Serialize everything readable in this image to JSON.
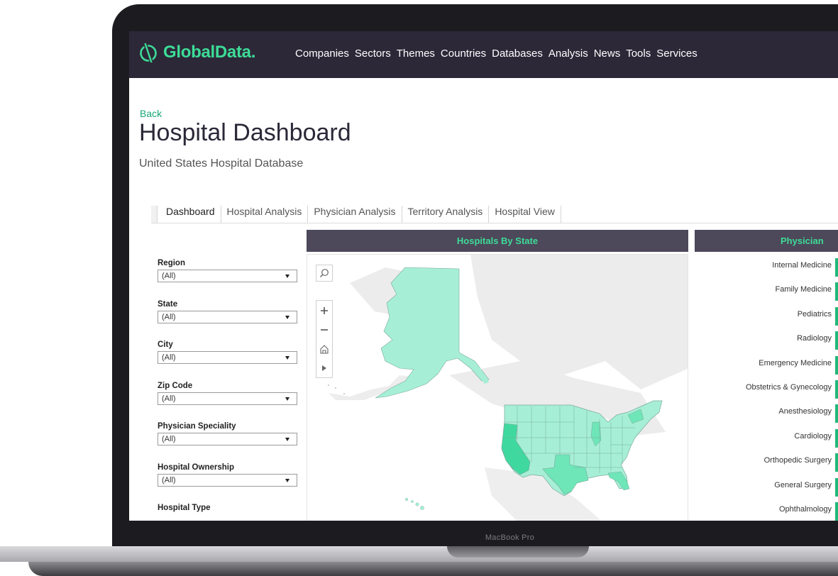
{
  "device": {
    "label": "MacBook Pro"
  },
  "brand": {
    "name": "GlobalData.",
    "color": "#3ddc97"
  },
  "nav": {
    "items": [
      "Companies",
      "Sectors",
      "Themes",
      "Countries",
      "Databases",
      "Analysis",
      "News",
      "Tools",
      "Services"
    ]
  },
  "page": {
    "back_label": "Back",
    "title": "Hospital Dashboard",
    "subtitle": "United States Hospital Database"
  },
  "tabs": [
    {
      "label": "Dashboard",
      "active": true
    },
    {
      "label": "Hospital Analysis",
      "active": false
    },
    {
      "label": "Physician Analysis",
      "active": false
    },
    {
      "label": "Territory Analysis",
      "active": false
    },
    {
      "label": "Hospital View",
      "active": false
    }
  ],
  "filters": [
    {
      "label": "Region",
      "value": "(All)"
    },
    {
      "label": "State",
      "value": "(All)"
    },
    {
      "label": "City",
      "value": "(All)"
    },
    {
      "label": "Zip Code",
      "value": "(All)"
    },
    {
      "label": "Physician Speciality",
      "value": "(All)"
    },
    {
      "label": "Hospital Ownership",
      "value": "(All)"
    },
    {
      "label": "Hospital Type",
      "value": ""
    }
  ],
  "map": {
    "title": "Hospitals By State",
    "tools": [
      "search-icon",
      "zoom-in-icon",
      "zoom-out-icon",
      "home-icon",
      "play-icon"
    ],
    "fill_color": "#a6efd6",
    "highlight_colors": [
      "#3fd9a0",
      "#6ee6b8"
    ]
  },
  "physicians": {
    "title": "Physician",
    "bar_color": "#22b87a",
    "specialties": [
      "Internal Medicine",
      "Family Medicine",
      "Pediatrics",
      "Radiology",
      "Emergency Medicine",
      "Obstetrics & Gynecology",
      "Anesthesiology",
      "Cardiology",
      "Orthopedic Surgery",
      "General Surgery",
      "Ophthalmology"
    ]
  }
}
